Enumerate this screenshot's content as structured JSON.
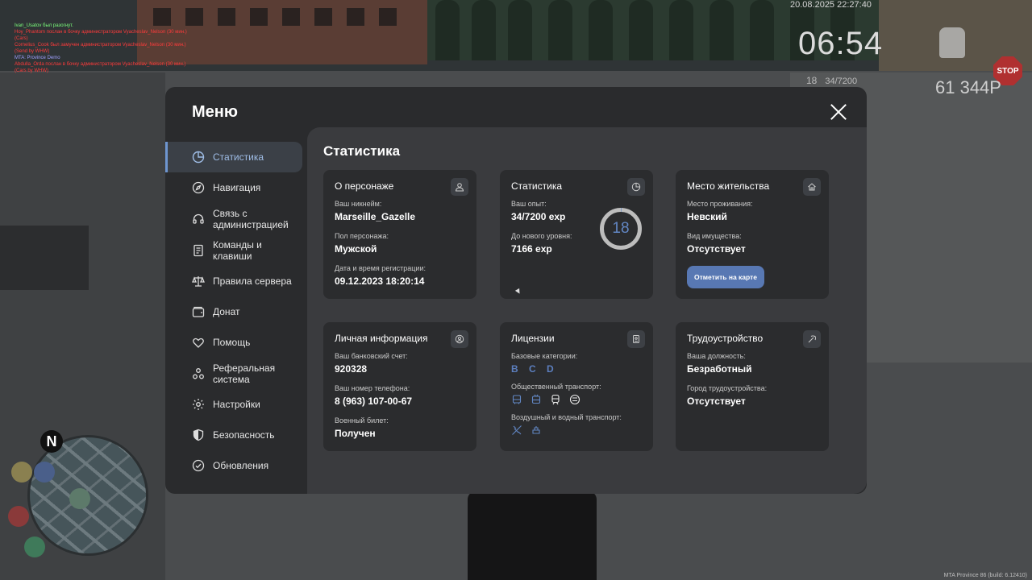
{
  "hud": {
    "chat": [
      {
        "text": "Ivan_Usatov был разогнут.",
        "color": "#7cff7c"
      },
      {
        "text": "Hoy_Phantom послан в бочку администратором Vyacheslav_Nelson (30 мин.)",
        "color": "#ff3b3b"
      },
      {
        "text": "(Cars)",
        "color": "#ff3b3b"
      },
      {
        "text": "Cornelius_Cook был замучен администратором Vyacheslav_Nelson (30 мин.)",
        "color": "#ff3b3b"
      },
      {
        "text": "(Send by WHW)",
        "color": "#ff3b3b"
      },
      {
        "text": "MTA: Province Demo",
        "color": "#a0a0ff"
      },
      {
        "text": "Abdulla_Orda послан в бочку администратором Vyacheslav_Nelson (30 мин.)",
        "color": "#ff3b3b"
      },
      {
        "text": "(Cars by WHW)",
        "color": "#ff3b3b"
      }
    ],
    "date": "20.08.2025 22:27:40",
    "time": "06:54",
    "level": "18",
    "exp": "34/7200",
    "money": "61 344P",
    "stop_sign": "STOP",
    "compass": "N",
    "build": "MTA Province 86 (build: 6.12410)"
  },
  "menu": {
    "title": "Меню",
    "sidebar": [
      {
        "label": "Статистика",
        "icon": "pie-chart-icon",
        "active": true
      },
      {
        "label": "Навигация",
        "icon": "compass-icon"
      },
      {
        "label": "Связь с администрацией",
        "icon": "headset-icon"
      },
      {
        "label": "Команды и клавиши",
        "icon": "document-icon"
      },
      {
        "label": "Правила сервера",
        "icon": "scales-icon"
      },
      {
        "label": "Донат",
        "icon": "wallet-icon"
      },
      {
        "label": "Помощь",
        "icon": "heart-hand-icon"
      },
      {
        "label": "Реферальная система",
        "icon": "share-nodes-icon"
      },
      {
        "label": "Настройки",
        "icon": "gear-icon"
      },
      {
        "label": "Безопасность",
        "icon": "shield-icon"
      },
      {
        "label": "Обновления",
        "icon": "check-circle-icon"
      }
    ],
    "content_title": "Статистика",
    "cards": {
      "character": {
        "title": "О персонаже",
        "nick_label": "Ваш никнейм:",
        "nick": "Marseille_Gazelle",
        "sex_label": "Пол персонажа:",
        "sex": "Мужской",
        "reg_label": "Дата и время регистрации:",
        "reg": "09.12.2023 18:20:14"
      },
      "stats": {
        "title": "Статистика",
        "exp_label": "Ваш опыт:",
        "exp": "34/7200 exp",
        "next_label": "До нового уровня:",
        "next": "7166 exp",
        "level": "18",
        "progress": 0.0047
      },
      "residence": {
        "title": "Место жительства",
        "place_label": "Место проживания:",
        "place": "Невский",
        "property_label": "Вид имущества:",
        "property": "Отсутствует",
        "map_button": "Отметить на карте"
      },
      "personal": {
        "title": "Личная информация",
        "bank_label": "Ваш банковский счет:",
        "bank": "920328",
        "phone_label": "Ваш номер телефона:",
        "phone": "8 (963) 107-00-67",
        "military_label": "Военный билет:",
        "military": "Получен"
      },
      "licenses": {
        "title": "Лицензии",
        "base_label": "Базовые категории:",
        "base": "B C D",
        "public_label": "Общественный транспорт:",
        "air_label": "Воздушный и водный транспорт:"
      },
      "job": {
        "title": "Трудоустройство",
        "position_label": "Ваша должность:",
        "position": "Безработный",
        "city_label": "Город трудоустройства:",
        "city": "Отсутствует"
      }
    }
  }
}
